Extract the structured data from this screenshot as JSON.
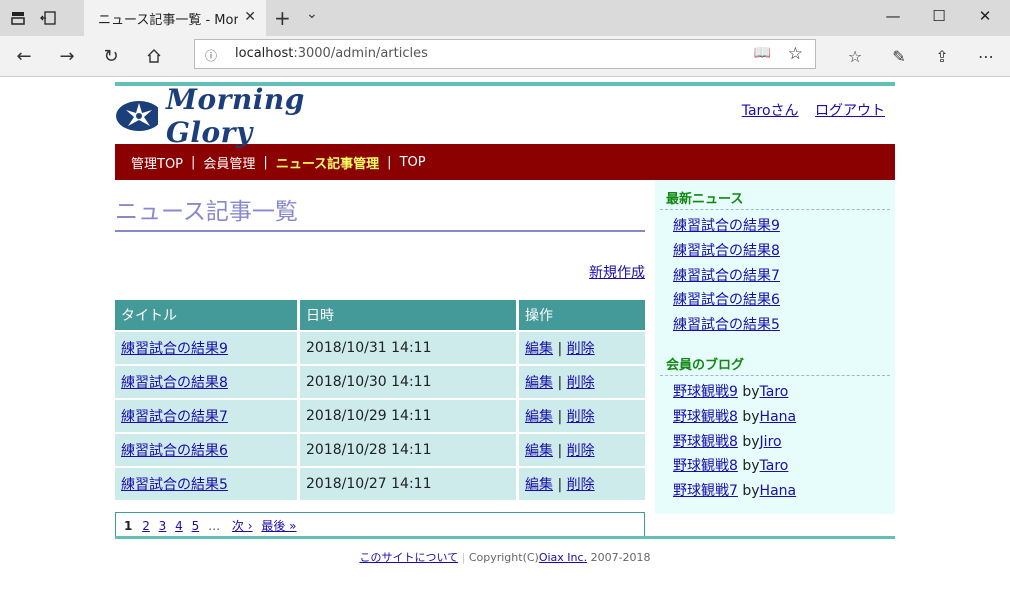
{
  "browser": {
    "tab_title": "ニュース記事一覧 - Morni",
    "url_host": "localhost",
    "url_rest": ":3000/admin/articles"
  },
  "header": {
    "logo_text": "Morning Glory",
    "user_link": "Taroさん",
    "logout_link": "ログアウト"
  },
  "menu": {
    "items": [
      "管理TOP",
      "会員管理",
      "ニュース記事管理",
      "TOP"
    ],
    "active_index": 2
  },
  "main": {
    "page_title": "ニュース記事一覧",
    "new_link": "新規作成",
    "columns": [
      "タイトル",
      "日時",
      "操作"
    ],
    "rows": [
      {
        "title": "練習試合の結果9",
        "date": "2018/10/31 14:11",
        "edit": "編集",
        "delete": "削除"
      },
      {
        "title": "練習試合の結果8",
        "date": "2018/10/30 14:11",
        "edit": "編集",
        "delete": "削除"
      },
      {
        "title": "練習試合の結果7",
        "date": "2018/10/29 14:11",
        "edit": "編集",
        "delete": "削除"
      },
      {
        "title": "練習試合の結果6",
        "date": "2018/10/28 14:11",
        "edit": "編集",
        "delete": "削除"
      },
      {
        "title": "練習試合の結果5",
        "date": "2018/10/27 14:11",
        "edit": "編集",
        "delete": "削除"
      }
    ],
    "pager": {
      "current": "1",
      "pages": [
        "2",
        "3",
        "4",
        "5"
      ],
      "dots": "…",
      "next": "次 ›",
      "last": "最後 »"
    }
  },
  "sidebar": {
    "news_heading": "最新ニュース",
    "news": [
      "練習試合の結果9",
      "練習試合の結果8",
      "練習試合の結果7",
      "練習試合の結果6",
      "練習試合の結果5"
    ],
    "blog_heading": "会員のブログ",
    "blogs": [
      {
        "title": "野球観戦9",
        "by": "by",
        "author": "Taro"
      },
      {
        "title": "野球観戦8",
        "by": "by",
        "author": "Hana"
      },
      {
        "title": "野球観戦8",
        "by": "by",
        "author": "Jiro"
      },
      {
        "title": "野球観戦8",
        "by": "by",
        "author": "Taro"
      },
      {
        "title": "野球観戦7",
        "by": "by",
        "author": "Hana"
      }
    ]
  },
  "footer": {
    "about_link": "このサイトについて",
    "copyright": "Copyright(C)",
    "company_link": "Oiax Inc.",
    "years": "2007-2018"
  }
}
